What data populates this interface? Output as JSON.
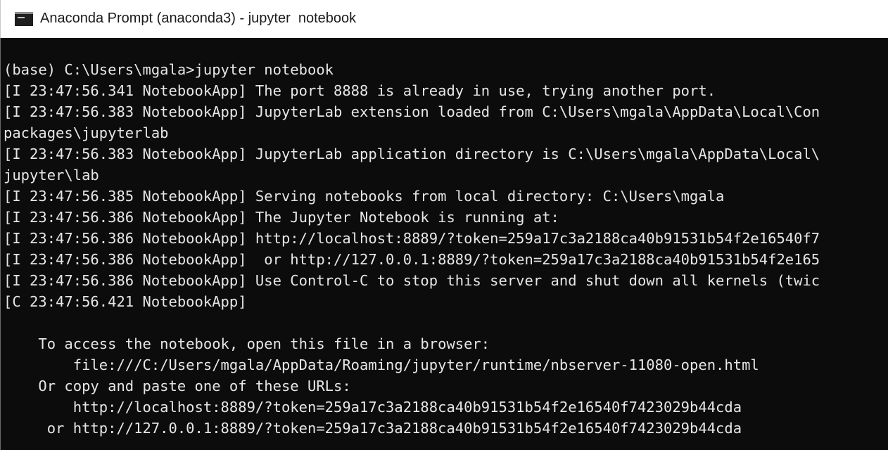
{
  "window": {
    "title": "Anaconda Prompt (anaconda3) - jupyter  notebook",
    "icon": "console-window-icon"
  },
  "console": {
    "lines": [
      "(base) C:\\Users\\mgala>jupyter notebook",
      "[I 23:47:56.341 NotebookApp] The port 8888 is already in use, trying another port.",
      "[I 23:47:56.383 NotebookApp] JupyterLab extension loaded from C:\\Users\\mgala\\AppData\\Local\\Con",
      "packages\\jupyterlab",
      "[I 23:47:56.383 NotebookApp] JupyterLab application directory is C:\\Users\\mgala\\AppData\\Local\\",
      "jupyter\\lab",
      "[I 23:47:56.385 NotebookApp] Serving notebooks from local directory: C:\\Users\\mgala",
      "[I 23:47:56.386 NotebookApp] The Jupyter Notebook is running at:",
      "[I 23:47:56.386 NotebookApp] http://localhost:8889/?token=259a17c3a2188ca40b91531b54f2e16540f7",
      "[I 23:47:56.386 NotebookApp]  or http://127.0.0.1:8889/?token=259a17c3a2188ca40b91531b54f2e165",
      "[I 23:47:56.386 NotebookApp] Use Control-C to stop this server and shut down all kernels (twic",
      "[C 23:47:56.421 NotebookApp]",
      "",
      "    To access the notebook, open this file in a browser:",
      "        file:///C:/Users/mgala/AppData/Roaming/jupyter/runtime/nbserver-11080-open.html",
      "    Or copy and paste one of these URLs:",
      "        http://localhost:8889/?token=259a17c3a2188ca40b91531b54f2e16540f7423029b44cda",
      "     or http://127.0.0.1:8889/?token=259a17c3a2188ca40b91531b54f2e16540f7423029b44cda"
    ]
  },
  "colors": {
    "console_background": "#0c0c0c",
    "console_text": "#e6e6e6",
    "titlebar_background": "#ffffff"
  }
}
